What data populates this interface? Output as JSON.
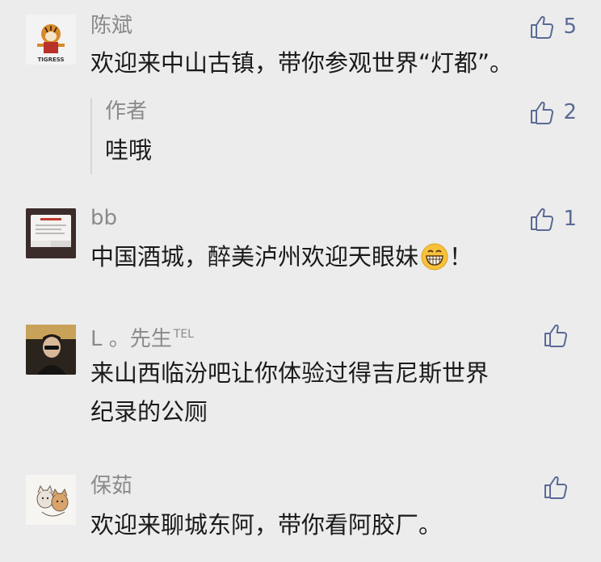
{
  "comments": [
    {
      "name": "陈斌",
      "text": "欢迎来中山古镇，带你参观世界“灯都”。",
      "likes": "5",
      "avatar_text": "TIGRESS",
      "reply": {
        "name": "作者",
        "text": "哇哦",
        "likes": "2"
      }
    },
    {
      "name": "bb",
      "text": "中国酒城，醉美泸州欢迎天眼妹",
      "text_suffix": "！",
      "likes": "1"
    },
    {
      "name": "L 。先生",
      "name_suffix": "TEL",
      "text_line1": "来山西临汾吧让你体验过得吉尼斯世界",
      "text_line2": "纪录的公厕",
      "likes": ""
    },
    {
      "name": "保茹",
      "text": "欢迎来聊城东阿，带你看阿胶厂。",
      "likes": ""
    }
  ],
  "icons": {
    "like": "thumbs-up-icon",
    "emoji": "grinning-face-icon"
  },
  "colors": {
    "background": "#ececec",
    "like_color": "#5a6a96",
    "name_color": "#8a8a8a",
    "text_color": "#1a1a1a"
  }
}
